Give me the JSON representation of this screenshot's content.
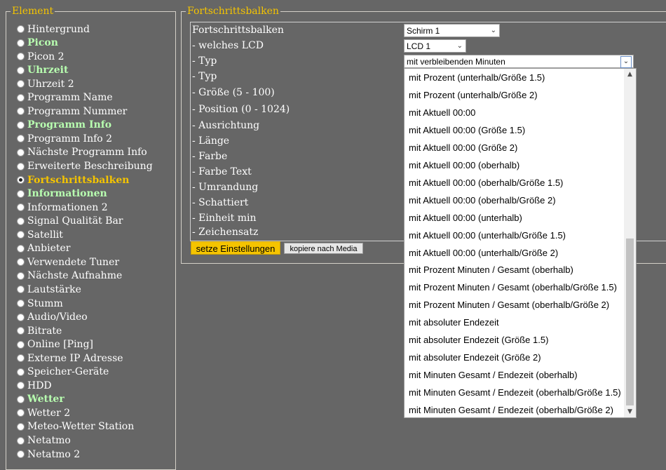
{
  "left_panel": {
    "legend": "Element",
    "items": [
      {
        "label": "Hintergrund",
        "style": "normal"
      },
      {
        "label": "Picon",
        "style": "green"
      },
      {
        "label": "Picon 2",
        "style": "normal"
      },
      {
        "label": "Uhrzeit",
        "style": "green"
      },
      {
        "label": "Uhrzeit 2",
        "style": "normal"
      },
      {
        "label": "Programm Name",
        "style": "normal"
      },
      {
        "label": "Programm Nummer",
        "style": "normal"
      },
      {
        "label": "Programm Info",
        "style": "green"
      },
      {
        "label": "Programm Info 2",
        "style": "normal"
      },
      {
        "label": "Nächste Programm Info",
        "style": "normal"
      },
      {
        "label": "Erweiterte Beschreibung",
        "style": "normal"
      },
      {
        "label": "Fortschrittsbalken",
        "style": "selected"
      },
      {
        "label": "Informationen",
        "style": "green"
      },
      {
        "label": "Informationen 2",
        "style": "normal"
      },
      {
        "label": "Signal Qualität Bar",
        "style": "normal"
      },
      {
        "label": "Satellit",
        "style": "normal"
      },
      {
        "label": "Anbieter",
        "style": "normal"
      },
      {
        "label": "Verwendete Tuner",
        "style": "normal"
      },
      {
        "label": "Nächste Aufnahme",
        "style": "normal"
      },
      {
        "label": "Lautstärke",
        "style": "normal"
      },
      {
        "label": "Stumm",
        "style": "normal"
      },
      {
        "label": "Audio/Video",
        "style": "normal"
      },
      {
        "label": "Bitrate",
        "style": "normal"
      },
      {
        "label": "Online [Ping]",
        "style": "normal"
      },
      {
        "label": "Externe IP Adresse",
        "style": "normal"
      },
      {
        "label": "Speicher-Geräte",
        "style": "normal"
      },
      {
        "label": "HDD",
        "style": "normal"
      },
      {
        "label": "Wetter",
        "style": "green"
      },
      {
        "label": "Wetter 2",
        "style": "normal"
      },
      {
        "label": "Meteo-Wetter Station",
        "style": "normal"
      },
      {
        "label": "Netatmo",
        "style": "normal"
      },
      {
        "label": "Netatmo 2",
        "style": "normal"
      }
    ]
  },
  "right_panel": {
    "legend": "Fortschrittsbalken",
    "rows": [
      "Fortschrittsbalken",
      "- welches LCD",
      "- Typ",
      "- Typ",
      "- Größe (5 - 100)",
      "- Position (0 - 1024)",
      "- Ausrichtung",
      "- Länge",
      "- Farbe",
      "- Farbe Text",
      "- Umrandung",
      "- Schattiert",
      "- Einheit min",
      "- Zeichensatz"
    ],
    "screen_select": "Schirm 1",
    "lcd_select": "LCD 1",
    "type_select": "mit verbleibenden Minuten",
    "save_button": "setze Einstellungen",
    "copy_button": "kopiere nach Media"
  },
  "dropdown": {
    "options": [
      "mit Prozent (unterhalb/Größe 1.5)",
      "mit Prozent (unterhalb/Größe 2)",
      "mit Aktuell 00:00",
      "mit Aktuell 00:00 (Größe 1.5)",
      "mit Aktuell 00:00 (Größe 2)",
      "mit Aktuell 00:00 (oberhalb)",
      "mit Aktuell 00:00 (oberhalb/Größe 1.5)",
      "mit Aktuell 00:00 (oberhalb/Größe 2)",
      "mit Aktuell 00:00 (unterhalb)",
      "mit Aktuell 00:00 (unterhalb/Größe 1.5)",
      "mit Aktuell 00:00 (unterhalb/Größe 2)",
      "mit Prozent Minuten / Gesamt (oberhalb)",
      "mit Prozent Minuten / Gesamt (oberhalb/Größe 1.5)",
      "mit Prozent Minuten / Gesamt (oberhalb/Größe 2)",
      "mit absoluter Endezeit",
      "mit absoluter Endezeit (Größe 1.5)",
      "mit absoluter Endezeit (Größe 2)",
      "mit Minuten Gesamt / Endezeit (oberhalb)",
      "mit Minuten Gesamt / Endezeit (oberhalb/Größe 1.5)",
      "mit Minuten Gesamt / Endezeit (oberhalb/Größe 2)"
    ]
  },
  "colors": {
    "background": "#666666",
    "legend": "#f5c400",
    "highlight_green": "#b8ffb0",
    "selected": "#f5c400",
    "save_button": "#f5c400"
  }
}
